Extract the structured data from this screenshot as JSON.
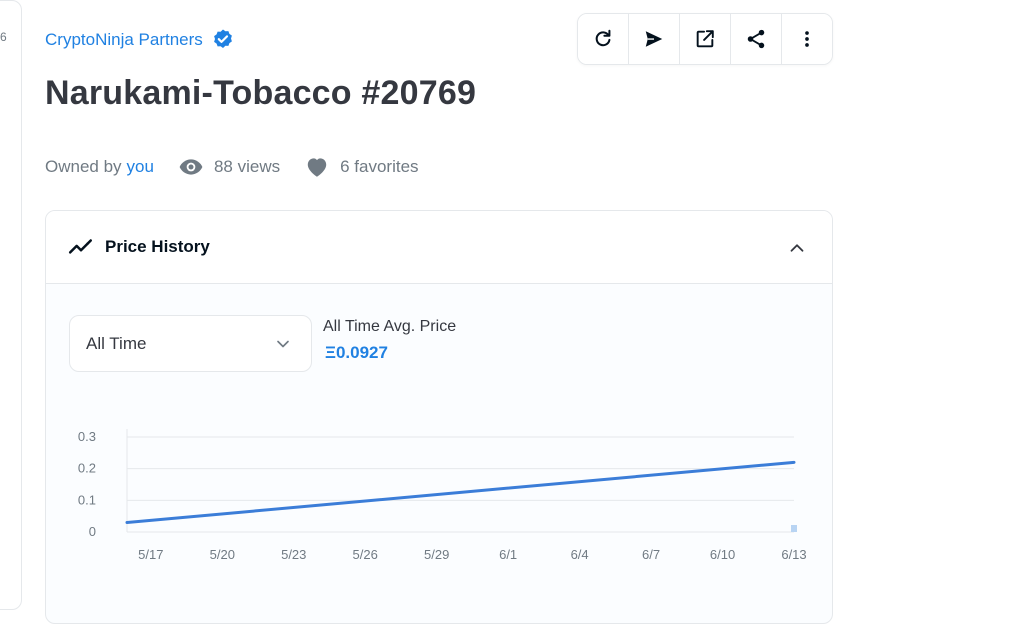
{
  "left_edge": {
    "text": "6"
  },
  "collection": {
    "name": "CryptoNinja Partners",
    "verified_icon": "verified-badge-icon"
  },
  "toolbar": {
    "buttons": [
      {
        "icon": "refresh-icon"
      },
      {
        "icon": "send-icon"
      },
      {
        "icon": "external-link-icon"
      },
      {
        "icon": "share-icon"
      },
      {
        "icon": "more-vertical-icon"
      }
    ]
  },
  "item": {
    "title": "Narukami-Tobacco #20769"
  },
  "meta": {
    "owned_by_label": "Owned by",
    "owner": "you",
    "views": "88 views",
    "favorites": "6 favorites"
  },
  "price_history": {
    "title": "Price History",
    "icon": "trending-line-icon",
    "collapse_icon": "chevron-up-icon",
    "period_select": "All Time",
    "avg_label": "All Time Avg. Price",
    "avg_value": "Ξ0.0927"
  },
  "colors": {
    "accent": "#2081e2",
    "line": "#3b7dd8",
    "text": "#353840",
    "muted": "#707a83"
  },
  "chart_data": {
    "type": "line",
    "title": "",
    "xlabel": "",
    "ylabel": "",
    "x_ticks": [
      "5/17",
      "5/20",
      "5/23",
      "5/26",
      "5/29",
      "6/1",
      "6/4",
      "6/7",
      "6/10",
      "6/13"
    ],
    "y_ticks": [
      "0",
      "0.1",
      "0.2",
      "0.3"
    ],
    "ylim": [
      0,
      0.3
    ],
    "xlim": [
      "5/16",
      "6/13"
    ],
    "grid": true,
    "series": [
      {
        "x": [
          "5/16",
          "6/13"
        ],
        "y": [
          0.03,
          0.22
        ]
      }
    ]
  }
}
